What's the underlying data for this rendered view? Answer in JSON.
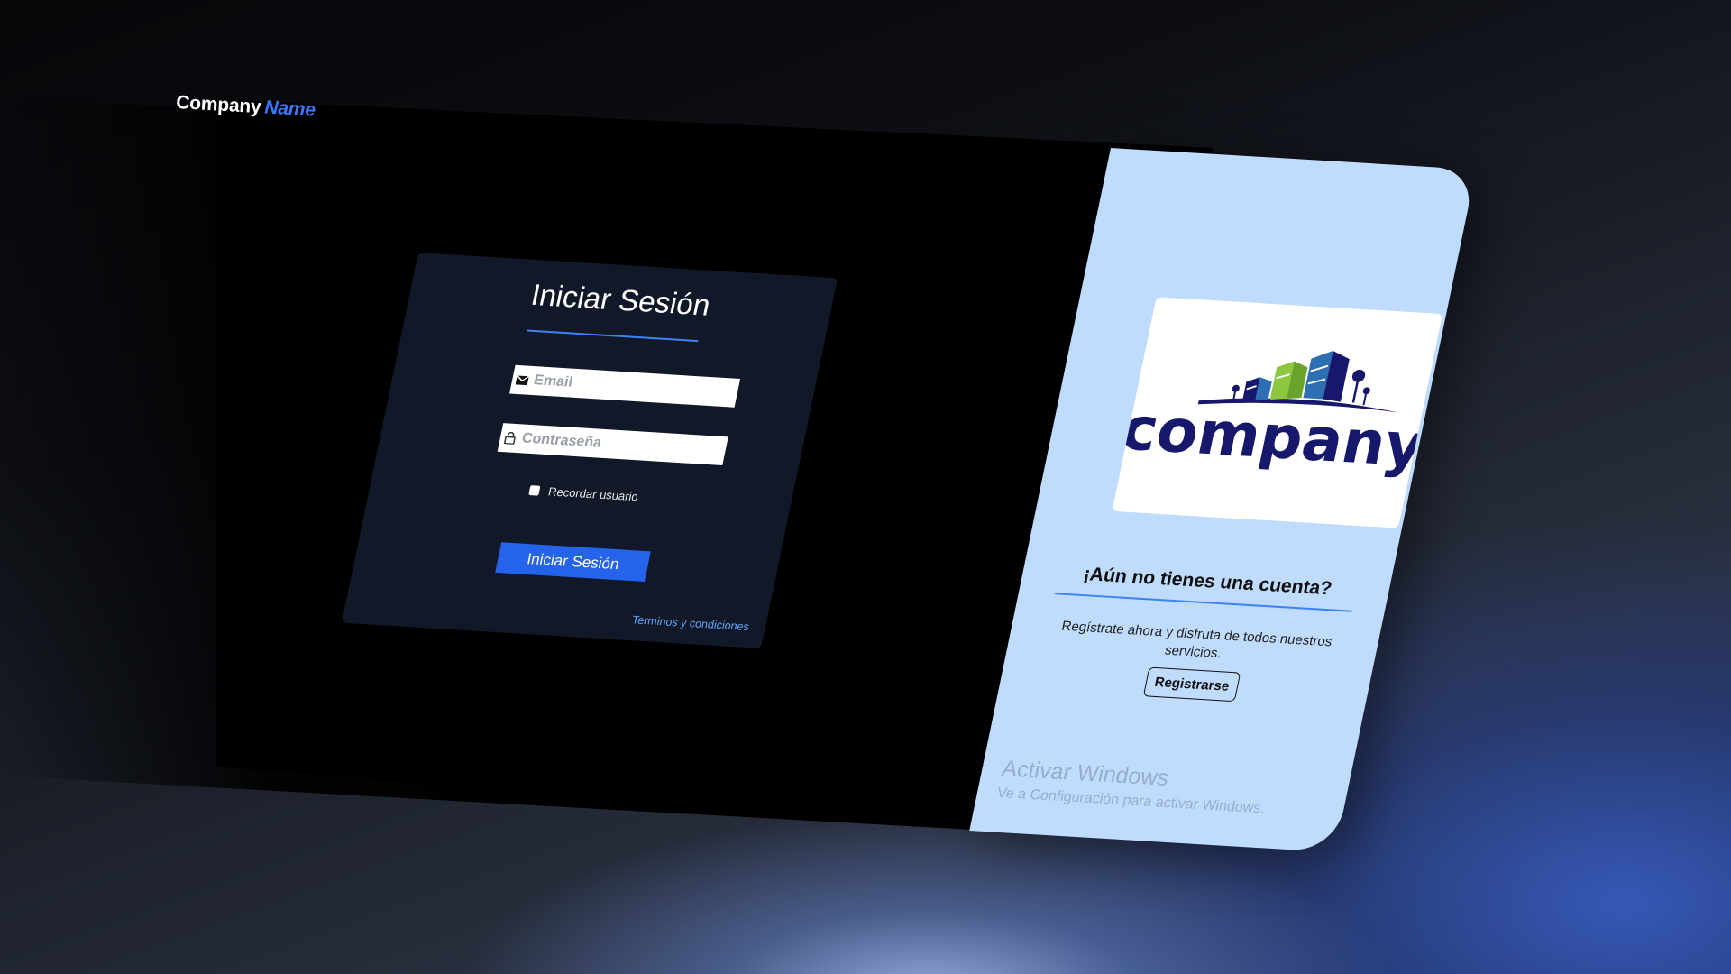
{
  "brand": {
    "part1": "Company",
    "part2": "Name"
  },
  "login": {
    "title": "Iniciar Sesión",
    "email_placeholder": "Email",
    "password_placeholder": "Contraseña",
    "remember_label": "Recordar usuario",
    "submit_label": "Iniciar Sesión",
    "terms_label": "Terminos y condiciones"
  },
  "register": {
    "logo_text": "company",
    "title": "¡Aún no tienes una cuenta?",
    "text": "Regístrate ahora y disfruta de todos nuestros servicios.",
    "button_label": "Registrarse"
  },
  "watermark": {
    "title": "Activar Windows",
    "subtitle": "Ve a Configuración para activar Windows."
  },
  "colors": {
    "accent": "#2563eb",
    "link": "#60a5fa",
    "card_bg": "#111827",
    "right_panel_bg": "#bfdbfe",
    "logo_navy": "#16196b",
    "logo_green": "#8dc63f",
    "logo_blue": "#2d6fb2"
  },
  "icons": {
    "email": "envelope-icon",
    "password": "lock-icon"
  }
}
